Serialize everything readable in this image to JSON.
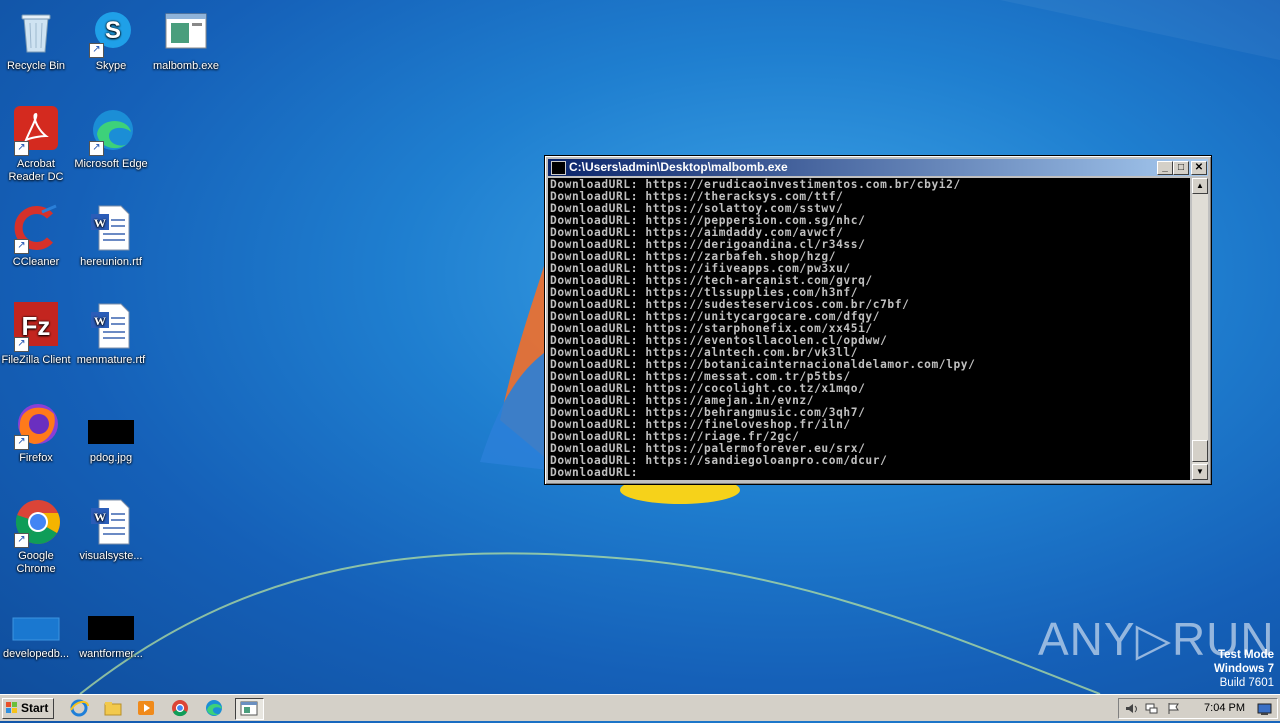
{
  "desktop": {
    "icons": [
      {
        "label": "Recycle Bin",
        "icon": "recycle-bin-icon"
      },
      {
        "label": "Skype",
        "icon": "skype-icon"
      },
      {
        "label": "malbomb.exe",
        "icon": "exe-icon"
      },
      {
        "label": "Acrobat Reader DC",
        "icon": "acrobat-icon"
      },
      {
        "label": "Microsoft Edge",
        "icon": "edge-icon"
      },
      {
        "label": "CCleaner",
        "icon": "ccleaner-icon"
      },
      {
        "label": "hereunion.rtf",
        "icon": "word-document-icon"
      },
      {
        "label": "FileZilla Client",
        "icon": "filezilla-icon"
      },
      {
        "label": "menmature.rtf",
        "icon": "word-document-icon"
      },
      {
        "label": "Firefox",
        "icon": "firefox-icon"
      },
      {
        "label": "pdog.jpg",
        "icon": "image-thumbnail-icon"
      },
      {
        "label": "Google Chrome",
        "icon": "chrome-icon"
      },
      {
        "label": "visualsyste...",
        "icon": "word-document-icon"
      },
      {
        "label": "developedb...",
        "icon": "file-icon"
      },
      {
        "label": "wantformer...",
        "icon": "image-thumbnail-icon"
      }
    ]
  },
  "console_window": {
    "title": "C:\\Users\\admin\\Desktop\\malbomb.exe",
    "lines": [
      "DownloadURL: https://erudicaoinvestimentos.com.br/cbyi2/",
      "DownloadURL: https://theracksys.com/ttf/",
      "DownloadURL: https://solattoy.com/sstwv/",
      "DownloadURL: https://peppersion.com.sg/nhc/",
      "DownloadURL: https://aimdaddy.com/avwcf/",
      "DownloadURL: https://derigoandina.cl/r34ss/",
      "DownloadURL: https://zarbafeh.shop/hzg/",
      "DownloadURL: https://ifiveapps.com/pw3xu/",
      "DownloadURL: https://tech-arcanist.com/gvrq/",
      "DownloadURL: https://tlssupplies.com/h3nf/",
      "DownloadURL: https://sudesteservicos.com.br/c7bf/",
      "DownloadURL: https://unitycargocare.com/dfqy/",
      "DownloadURL: https://starphonefix.com/xx45i/",
      "DownloadURL: https://eventosllacolen.cl/opdww/",
      "DownloadURL: https://alntech.com.br/vk3ll/",
      "DownloadURL: https://botanicainternacionaldelamor.com/lpy/",
      "DownloadURL: https://messat.com.tr/p5tbs/",
      "DownloadURL: https://cocolight.co.tz/x1mqo/",
      "DownloadURL: https://amejan.in/evnz/",
      "DownloadURL: https://behrangmusic.com/3qh7/",
      "DownloadURL: https://fineloveshop.fr/iln/",
      "DownloadURL: https://riage.fr/2gc/",
      "DownloadURL: https://palermoforever.eu/srx/",
      "DownloadURL: https://sandiegoloanpro.com/dcur/",
      "DownloadURL:"
    ],
    "minimize_glyph": "_",
    "maximize_glyph": "□",
    "close_glyph": "✕"
  },
  "watermark": {
    "brand": "ANY▷RUN",
    "line1": "Test Mode",
    "line2": "Windows 7",
    "line3": "Build 7601"
  },
  "taskbar": {
    "start_label": "Start",
    "items": [
      "ie-icon",
      "explorer-icon",
      "media-player-icon",
      "chrome-icon",
      "edge-icon",
      "console-icon"
    ],
    "clock": "7:04 PM",
    "tray_icons": [
      "speaker-icon",
      "network-icon",
      "flag-icon",
      "show-desktop-icon"
    ]
  },
  "colors": {
    "console_bg": "#000000",
    "console_text": "#c0c0c0",
    "titlebar_start": "#0a246a",
    "titlebar_end": "#a6caf0"
  }
}
